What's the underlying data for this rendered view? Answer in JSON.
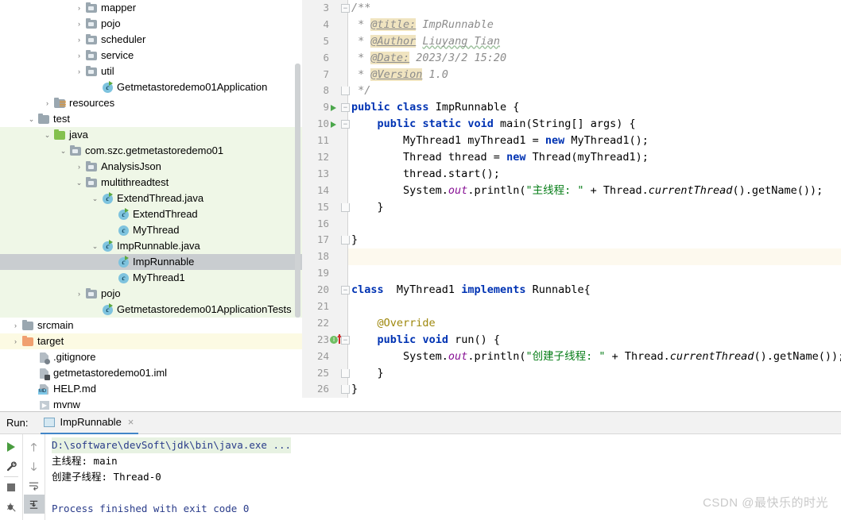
{
  "project_tree": {
    "rows": [
      {
        "label": "mapper",
        "indent": 5,
        "arrow": "›",
        "icon": "folder-package-icon",
        "state": "normal"
      },
      {
        "label": "pojo",
        "indent": 5,
        "arrow": "›",
        "icon": "folder-package-icon",
        "state": "normal"
      },
      {
        "label": "scheduler",
        "indent": 5,
        "arrow": "›",
        "icon": "folder-package-icon",
        "state": "normal"
      },
      {
        "label": "service",
        "indent": 5,
        "arrow": "›",
        "icon": "folder-package-icon",
        "state": "normal"
      },
      {
        "label": "util",
        "indent": 5,
        "arrow": "›",
        "icon": "folder-package-icon",
        "state": "normal"
      },
      {
        "label": "Getmetastoredemo01Application",
        "indent": 6,
        "arrow": "",
        "icon": "java-class-runnable-icon",
        "state": "normal"
      },
      {
        "label": "resources",
        "indent": 3,
        "arrow": "›",
        "icon": "folder-resources-icon",
        "state": "normal"
      },
      {
        "label": "test",
        "indent": 2,
        "arrow": "⌄",
        "icon": "folder-icon",
        "state": "normal"
      },
      {
        "label": "java",
        "indent": 3,
        "arrow": "⌄",
        "icon": "folder-test-source-icon",
        "state": "src-test"
      },
      {
        "label": "com.szc.getmetastoredemo01",
        "indent": 4,
        "arrow": "⌄",
        "icon": "folder-package-icon",
        "state": "src-test"
      },
      {
        "label": "AnalysisJson",
        "indent": 5,
        "arrow": "›",
        "icon": "folder-package-icon",
        "state": "src-test"
      },
      {
        "label": "multithreadtest",
        "indent": 5,
        "arrow": "⌄",
        "icon": "folder-package-icon",
        "state": "src-test"
      },
      {
        "label": "ExtendThread.java",
        "indent": 6,
        "arrow": "⌄",
        "icon": "java-class-runnable-icon",
        "state": "src-test"
      },
      {
        "label": "ExtendThread",
        "indent": 7,
        "arrow": "",
        "icon": "java-class-runnable-icon",
        "state": "src-test"
      },
      {
        "label": "MyThread",
        "indent": 7,
        "arrow": "",
        "icon": "java-class-icon",
        "state": "src-test"
      },
      {
        "label": "ImpRunnable.java",
        "indent": 6,
        "arrow": "⌄",
        "icon": "java-class-runnable-icon",
        "state": "src-test"
      },
      {
        "label": "ImpRunnable",
        "indent": 7,
        "arrow": "",
        "icon": "java-class-runnable-icon",
        "state": "selected"
      },
      {
        "label": "MyThread1",
        "indent": 7,
        "arrow": "",
        "icon": "java-class-icon",
        "state": "src-test"
      },
      {
        "label": "pojo",
        "indent": 5,
        "arrow": "›",
        "icon": "folder-package-icon",
        "state": "src-test"
      },
      {
        "label": "Getmetastoredemo01ApplicationTests",
        "indent": 6,
        "arrow": "",
        "icon": "java-class-runnable-icon",
        "state": "src-test"
      },
      {
        "label": "srcmain",
        "indent": 1,
        "arrow": "›",
        "icon": "folder-icon",
        "state": "normal"
      },
      {
        "label": "target",
        "indent": 1,
        "arrow": "›",
        "icon": "folder-excluded-icon",
        "state": "target"
      },
      {
        "label": ".gitignore",
        "indent": 2,
        "arrow": "",
        "icon": "gitignore-file-icon",
        "state": "normal"
      },
      {
        "label": "getmetastoredemo01.iml",
        "indent": 2,
        "arrow": "",
        "icon": "iml-file-icon",
        "state": "normal"
      },
      {
        "label": "HELP.md",
        "indent": 2,
        "arrow": "",
        "icon": "markdown-file-icon",
        "state": "normal"
      },
      {
        "label": "mvnw",
        "indent": 2,
        "arrow": "",
        "icon": "script-file-icon",
        "state": "normal"
      }
    ]
  },
  "editor": {
    "lines": [
      {
        "num": "3",
        "gutter": "",
        "fold": "open",
        "caret": false
      },
      {
        "num": "4",
        "gutter": "",
        "fold": "",
        "caret": false
      },
      {
        "num": "5",
        "gutter": "",
        "fold": "",
        "caret": false
      },
      {
        "num": "6",
        "gutter": "",
        "fold": "",
        "caret": false
      },
      {
        "num": "7",
        "gutter": "",
        "fold": "",
        "caret": false
      },
      {
        "num": "8",
        "gutter": "",
        "fold": "tail",
        "caret": false
      },
      {
        "num": "9",
        "gutter": "run",
        "fold": "open",
        "caret": false
      },
      {
        "num": "10",
        "gutter": "run",
        "fold": "open",
        "caret": false
      },
      {
        "num": "11",
        "gutter": "",
        "fold": "",
        "caret": false
      },
      {
        "num": "12",
        "gutter": "",
        "fold": "",
        "caret": false
      },
      {
        "num": "13",
        "gutter": "",
        "fold": "",
        "caret": false
      },
      {
        "num": "14",
        "gutter": "",
        "fold": "",
        "caret": false
      },
      {
        "num": "15",
        "gutter": "",
        "fold": "tail",
        "caret": false
      },
      {
        "num": "16",
        "gutter": "",
        "fold": "",
        "caret": false
      },
      {
        "num": "17",
        "gutter": "",
        "fold": "tail",
        "caret": false
      },
      {
        "num": "18",
        "gutter": "",
        "fold": "",
        "caret": true
      },
      {
        "num": "19",
        "gutter": "",
        "fold": "",
        "caret": false
      },
      {
        "num": "20",
        "gutter": "",
        "fold": "open",
        "caret": false
      },
      {
        "num": "21",
        "gutter": "",
        "fold": "",
        "caret": false
      },
      {
        "num": "22",
        "gutter": "",
        "fold": "",
        "caret": false
      },
      {
        "num": "23",
        "gutter": "impl",
        "fold": "open",
        "caret": false
      },
      {
        "num": "24",
        "gutter": "",
        "fold": "",
        "caret": false
      },
      {
        "num": "25",
        "gutter": "",
        "fold": "tail",
        "caret": false
      },
      {
        "num": "26",
        "gutter": "",
        "fold": "tail",
        "caret": false
      }
    ],
    "source_text": [
      "/**",
      " * @title: ImpRunnable",
      " * @Author Liuyang Tian",
      " * @Date: 2023/3/2 15:20",
      " * @Version 1.0",
      " */",
      "public class ImpRunnable {",
      "    public static void main(String[] args) {",
      "        MyThread1 myThread1 = new MyThread1();",
      "        Thread thread = new Thread(myThread1);",
      "        thread.start();",
      "        System.out.println(\"主线程: \" + Thread.currentThread().getName());",
      "    }",
      "",
      "}",
      "",
      "",
      "class  MyThread1 implements Runnable{",
      "",
      "    @Override",
      "    public void run() {",
      "        System.out.println(\"创建子线程: \" + Thread.currentThread().getName());",
      "    }",
      "}"
    ],
    "javadoc": {
      "title_tag": "@title:",
      "title_value": "ImpRunnable",
      "author_tag": "@Author",
      "author_value": "Liuyang Tian",
      "date_tag": "@Date:",
      "date_value": "2023/3/2 15:20",
      "version_tag": "@Version",
      "version_value": "1.0"
    }
  },
  "run_panel": {
    "label": "Run:",
    "tab_name": "ImpRunnable",
    "close_glyph": "×",
    "toolbar": [
      {
        "name": "rerun-button",
        "glyph": "play"
      },
      {
        "name": "settings-button",
        "glyph": "🔧"
      },
      {
        "name": "stop-button",
        "glyph": "stop"
      },
      {
        "name": "print-button",
        "glyph": "🐞"
      }
    ],
    "toolbar2": [
      {
        "name": "up-arrow-button",
        "glyph": "↑"
      },
      {
        "name": "down-arrow-button",
        "glyph": "↓"
      },
      {
        "name": "soft-wrap-button",
        "glyph": "↩"
      },
      {
        "name": "scroll-to-end-button",
        "glyph": "⇥"
      }
    ],
    "console_lines": [
      {
        "text": "D:\\software\\devSoft\\jdk\\bin\\java.exe ...",
        "style": "cmd"
      },
      {
        "text": "主线程: main",
        "style": "out"
      },
      {
        "text": "创建子线程: Thread-0",
        "style": "out"
      },
      {
        "text": "",
        "style": "out"
      },
      {
        "text": "Process finished with exit code 0",
        "style": "fin"
      }
    ]
  },
  "watermark": {
    "text": "CSDN @最快乐的时光"
  },
  "colors": {
    "test_source_bg": "#eff7e7",
    "selection_bg": "#c9cdd0",
    "target_bg": "#fcfae3",
    "caret_line_bg": "#fdf9ee",
    "keyword": "#0033b3",
    "string": "#067d17",
    "comment": "#8c8c8c",
    "field": "#871094",
    "annotation": "#9e880d",
    "tab_underline": "#4286c8"
  }
}
